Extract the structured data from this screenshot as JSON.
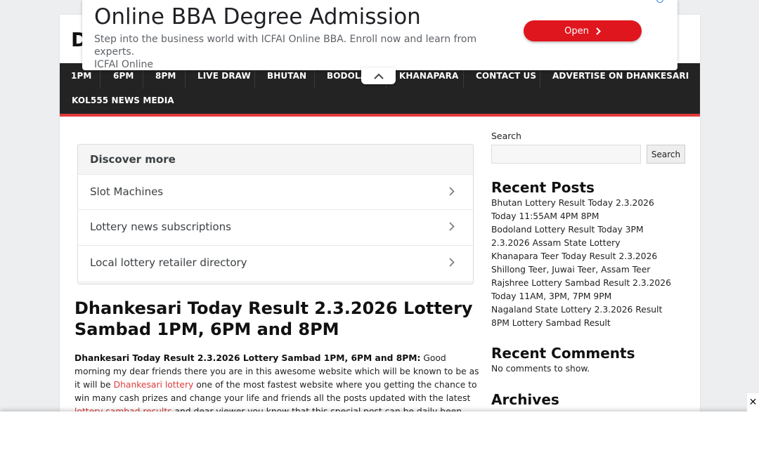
{
  "site": {
    "logo_letter": "D"
  },
  "ad_top": {
    "title": "Online BBA Degree Admission",
    "description": "Step into the business world with ICFAI Online BBA. Enroll now and learn from experts.",
    "advertiser": "ICFAI Online",
    "open_label": "Open"
  },
  "nav": {
    "items": [
      "1PM",
      "6PM",
      "8PM",
      "LIVE DRAW",
      "BHUTAN",
      "BODOLA",
      "KHANAPARA",
      "CONTACT US",
      "ADVERTISE ON DHANKESARI",
      "KOL555 NEWS MEDIA"
    ]
  },
  "discover": {
    "title": "Discover more",
    "items": [
      "Slot Machines",
      "Lottery news subscriptions",
      "Local lottery retailer directory"
    ]
  },
  "post": {
    "title": "Dhankesari Today Result 2.3.2026 Lottery Sambad 1PM, 6PM and 8PM",
    "lead_bold": "Dhankesari Today Result 2.3.2026 Lottery Sambad 1PM, 6PM and 8PM:",
    "text1": " Good morning my dear friends there you are in this awesome website which will be known to be as it will be ",
    "link1": "Dhankesari lottery",
    "text2": " one of the most fastest website where you getting the chance to win many cash prizes and change your life and friends all the posts updated with the latest ",
    "link2": "lottery sambad results",
    "text3": " and dear viewer you know that this special post can be daily been updated with the peoples most favourite and peoples most"
  },
  "sidebar": {
    "search_label": "Search",
    "search_button": "Search",
    "recent_posts_title": "Recent Posts",
    "recent_posts": [
      "Bhutan Lottery Result Today 2.3.2026 Today 11:55AM 4PM 8PM",
      "Bodoland Lottery Result Today 3PM 2.3.2026 Assam State Lottery",
      "Khanapara Teer Today Result 2.3.2026 Shillong Teer, Juwai Teer, Assam Teer",
      "Rajshree Lottery Sambad Result 2.3.2026 Today 11AM, 3PM, 7PM 9PM",
      "Nagaland State Lottery 2.3.2026 Result 8PM Lottery Sambad Result"
    ],
    "recent_comments_title": "Recent Comments",
    "no_comments": "No comments to show.",
    "archives_title": "Archives"
  },
  "bottom_ad": {
    "close_label": "✕"
  },
  "colors": {
    "accent": "#e03a3a",
    "nav_bg": "#232323",
    "ad_button": "#e0161e"
  }
}
